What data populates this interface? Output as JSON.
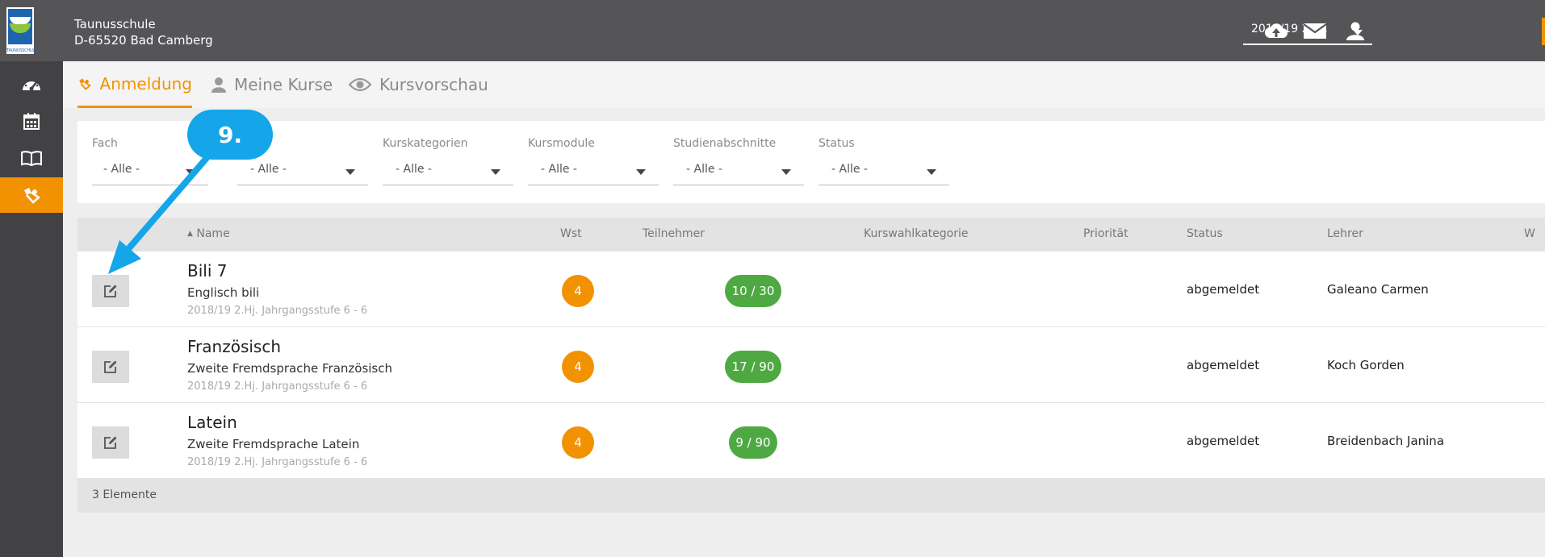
{
  "header": {
    "school_name": "Taunusschule",
    "school_address": "D-65520 Bad Camberg",
    "logo_text": "TAUNUSSCHULE",
    "term_select": "2018/19 2.Hj."
  },
  "tabs": [
    {
      "label": "Anmeldung"
    },
    {
      "label": "Meine Kurse"
    },
    {
      "label": "Kursvorschau"
    }
  ],
  "filters": [
    {
      "label": "Fach",
      "value": "- Alle -"
    },
    {
      "label": "",
      "value": "- Alle -"
    },
    {
      "label": "Kurskategorien",
      "value": "- Alle -"
    },
    {
      "label": "Kursmodule",
      "value": "- Alle -"
    },
    {
      "label": "Studienabschnitte",
      "value": "- Alle -"
    },
    {
      "label": "Status",
      "value": "- Alle -"
    }
  ],
  "table": {
    "columns": {
      "name": "Name",
      "wst": "Wst",
      "teilnehmer": "Teilnehmer",
      "kurswahlkategorie": "Kurswahlkategorie",
      "prioritaet": "Priorität",
      "status": "Status",
      "lehrer": "Lehrer",
      "cut": "W"
    },
    "rows": [
      {
        "name": "Bili 7",
        "subject": "Englisch bili",
        "meta": "2018/19 2.Hj. Jahrgangsstufe 6 - 6",
        "wst": "4",
        "participants": "10 / 30",
        "status": "abgemeldet",
        "teacher": "Galeano Carmen"
      },
      {
        "name": "Französisch",
        "subject": "Zweite Fremdsprache Französisch",
        "meta": "2018/19 2.Hj. Jahrgangsstufe 6 - 6",
        "wst": "4",
        "participants": "17 / 90",
        "status": "abgemeldet",
        "teacher": "Koch Gorden"
      },
      {
        "name": "Latein",
        "subject": "Zweite Fremdsprache Latein",
        "meta": "2018/19 2.Hj. Jahrgangsstufe 6 - 6",
        "wst": "4",
        "participants": "9 / 90",
        "status": "abgemeldet",
        "teacher": "Breidenbach Janina"
      }
    ],
    "footer": "3 Elemente"
  },
  "annotation": {
    "step": "9."
  },
  "icons": {
    "sidebar": [
      "dashboard-icon",
      "calendar-icon",
      "book-icon",
      "registration-icon"
    ],
    "top": [
      "cloud-upload-icon",
      "mail-icon",
      "user-icon"
    ],
    "tabs": [
      "registration-icon",
      "user-icon",
      "eye-icon"
    ],
    "row": "edit-icon"
  },
  "colors": {
    "accent": "#f39200",
    "topbar": "#555558",
    "sidebar": "#424244",
    "badge_blue": "#14a6e8",
    "participants_green": "#4fa943"
  }
}
